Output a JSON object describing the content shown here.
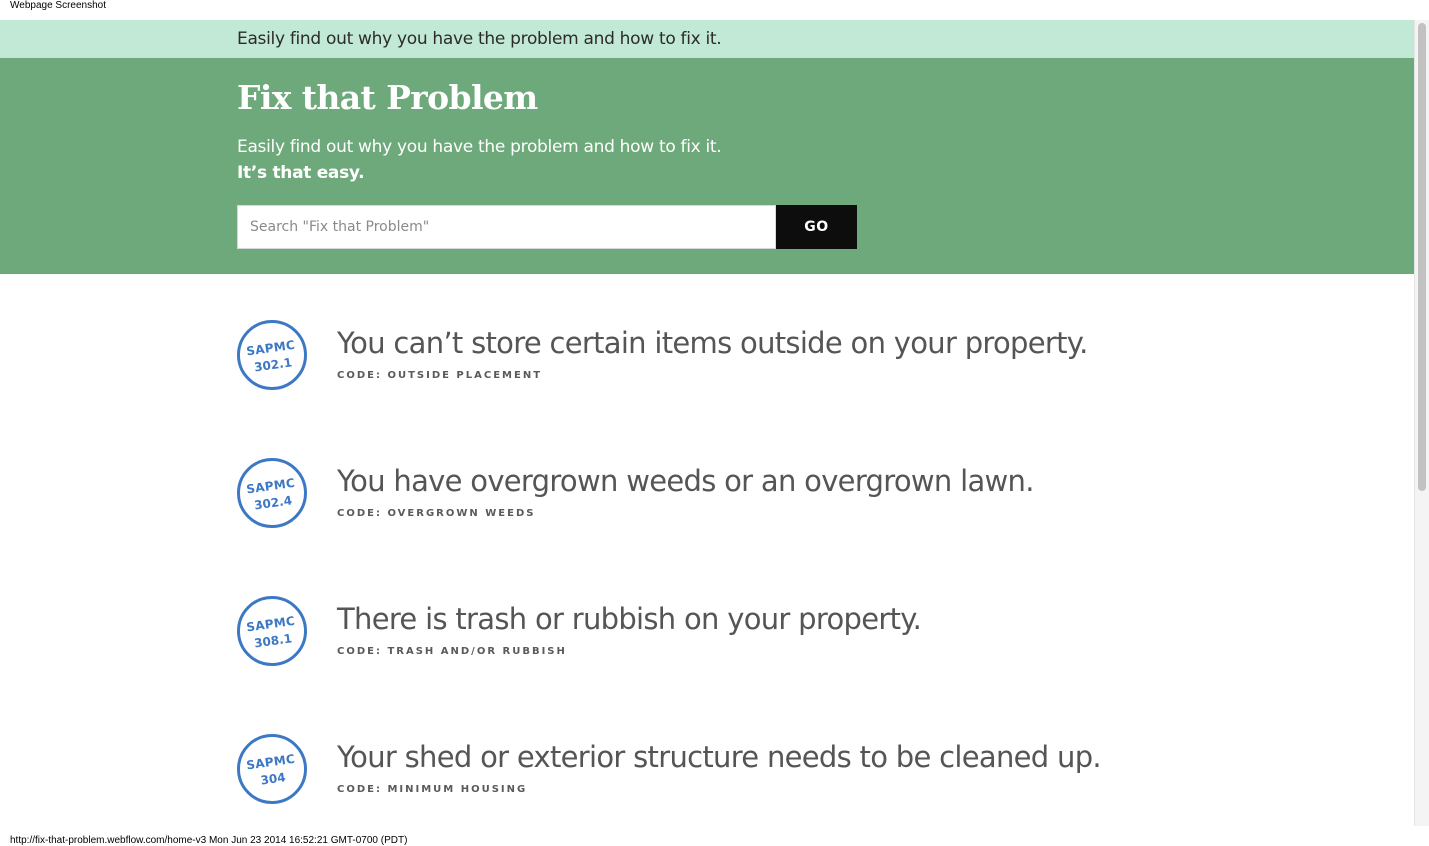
{
  "screenshot_label": "Webpage Screenshot",
  "footer_url": "http://fix-that-problem.webflow.com/home-v3 Mon Jun 23 2014 16:52:21 GMT-0700 (PDT)",
  "top_banner": {
    "text": "Easily find out why you have the problem and how to fix it."
  },
  "hero": {
    "title": "Fix that Problem",
    "subtitle": "Easily find out why you have the problem and how to fix it.",
    "subtitle_bold": "It’s that easy.",
    "search_placeholder": "Search \"Fix that Problem\"",
    "go_label": "GO"
  },
  "problems": [
    {
      "badge_line1": "SAPMC",
      "badge_line2": "302.1",
      "title": "You can’t store certain items outside on your property.",
      "code": "CODE: OUTSIDE PLACEMENT"
    },
    {
      "badge_line1": "SAPMC",
      "badge_line2": "302.4",
      "title": "You have overgrown weeds or an overgrown lawn.",
      "code": "CODE: OVERGROWN WEEDS"
    },
    {
      "badge_line1": "SAPMC",
      "badge_line2": "308.1",
      "title": "There is trash or rubbish on your property.",
      "code": "CODE: TRASH AND/OR RUBBISH"
    },
    {
      "badge_line1": "SAPMC",
      "badge_line2": "304",
      "title": "Your shed or exterior structure needs to be cleaned up.",
      "code": "CODE: MINIMUM HOUSING"
    }
  ],
  "colors": {
    "banner_bg": "#c2e9d5",
    "hero_bg": "#6da97a",
    "badge_blue": "#3d78c4",
    "button_bg": "#0d0d0d"
  }
}
